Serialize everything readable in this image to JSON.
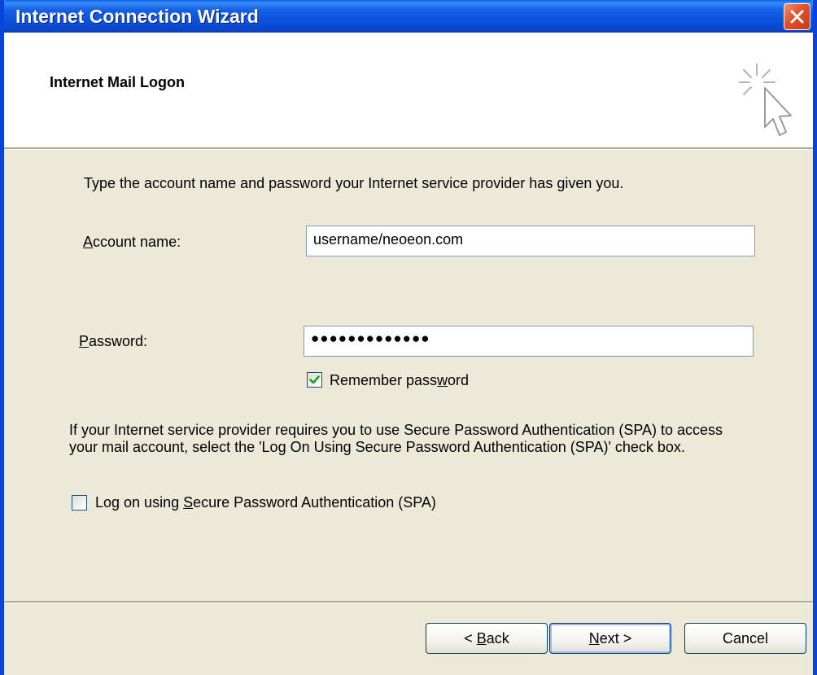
{
  "window": {
    "title": "Internet Connection Wizard"
  },
  "header": {
    "title": "Internet Mail Logon",
    "icon": "wizard-cursor-icon"
  },
  "form": {
    "instructions": "Type the account name and password your Internet service provider has given you.",
    "account_label_accel": "A",
    "account_label_rest": "ccount name:",
    "account_value": "username/neoeon.com",
    "password_label_accel": "P",
    "password_label_rest": "assword:",
    "password_value": "●●●●●●●●●●●●●",
    "remember_label_pre": "Remember pass",
    "remember_label_accel": "w",
    "remember_label_post": "ord",
    "remember_checked": true,
    "spa_text": "If your Internet service provider requires you to use Secure Password Authentication (SPA) to access your mail account, select the 'Log On Using Secure Password Authentication (SPA)' check box.",
    "spa_label_pre": "Log on using ",
    "spa_label_accel": "S",
    "spa_label_post": "ecure Password Authentication (SPA)",
    "spa_checked": false
  },
  "buttons": {
    "back_pre": "< ",
    "back_accel": "B",
    "back_post": "ack",
    "next_accel": "N",
    "next_post": "ext >",
    "cancel": "Cancel"
  },
  "colors": {
    "titlebar": "#0a4fd8",
    "close_button": "#e0502a",
    "dialog_background": "#ece9d8",
    "checkmark": "#21a121"
  }
}
